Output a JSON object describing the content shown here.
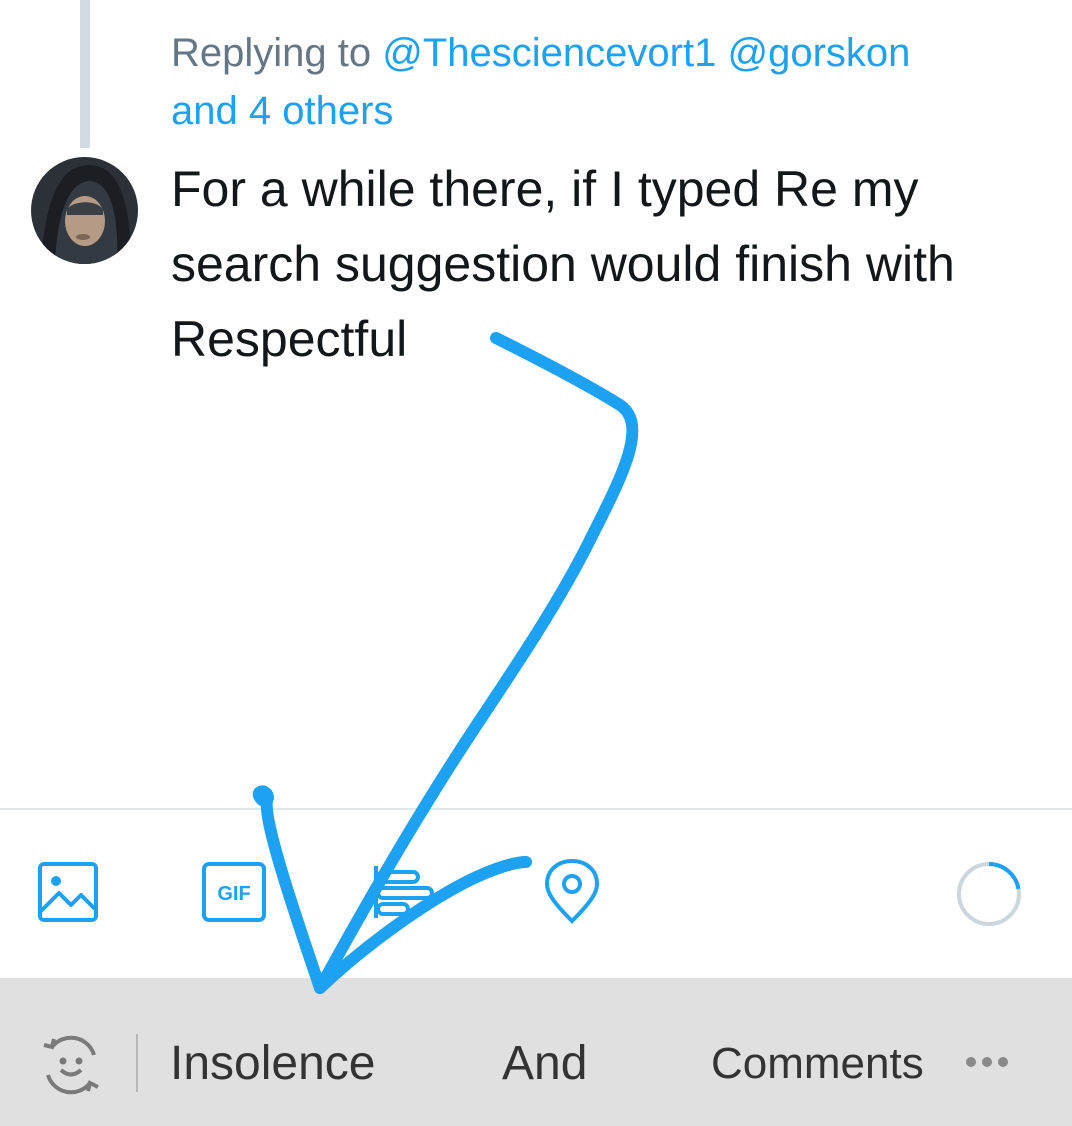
{
  "reply": {
    "prefix": "Replying to",
    "mentions": [
      "@Thesciencevort1",
      "@gorskon"
    ],
    "others": "and 4 others"
  },
  "tweet": {
    "lines": [
      "For a while there, if I typed Re my",
      "search suggestion would finish with",
      "Respectful"
    ]
  },
  "toolbar": {
    "gif_label": "GIF",
    "icons": [
      "image-icon",
      "gif-icon",
      "poll-icon",
      "location-icon"
    ]
  },
  "keyboard": {
    "suggestions": [
      "Insolence",
      "And",
      "Comments"
    ],
    "icons": [
      "emoji-toggle-icon",
      "more-icon"
    ]
  },
  "colors": {
    "accent": "#1da1f2",
    "annotation": "#1da1f2",
    "suggestion_bar": "#e0e0e0"
  }
}
